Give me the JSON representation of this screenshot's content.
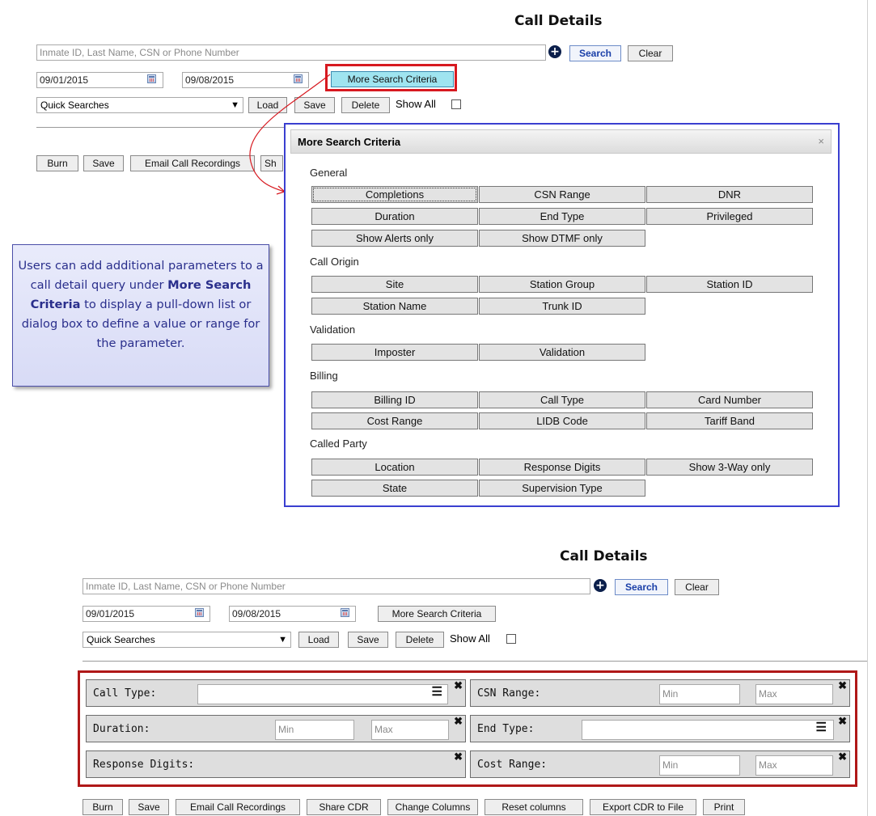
{
  "top": {
    "title": "Call Details",
    "search_placeholder": "Inmate ID, Last Name, CSN or Phone Number",
    "search_label": "Search",
    "clear_label": "Clear",
    "start_date": "09/01/2015",
    "end_date": "09/08/2015",
    "more_label": "More Search Criteria",
    "quick_searches": "Quick Searches",
    "load_label": "Load",
    "save_label": "Save",
    "delete_label": "Delete",
    "show_all_label": "Show All",
    "action_buttons": [
      "Burn",
      "Save",
      "Email Call Recordings",
      "Sh"
    ]
  },
  "dialog": {
    "title": "More Search Criteria",
    "close": "×",
    "sections": {
      "general": {
        "label": "General",
        "items": [
          "Completions",
          "CSN Range",
          "DNR",
          "Duration",
          "End Type",
          "Privileged",
          "Show Alerts only",
          "Show DTMF only"
        ]
      },
      "call_origin": {
        "label": "Call Origin",
        "items": [
          "Site",
          "Station Group",
          "Station ID",
          "Station Name",
          "Trunk ID"
        ]
      },
      "validation": {
        "label": "Validation",
        "items": [
          "Imposter",
          "Validation"
        ]
      },
      "billing": {
        "label": "Billing",
        "items": [
          "Billing ID",
          "Call Type",
          "Card Number",
          "Cost Range",
          "LIDB Code",
          "Tariff Band"
        ]
      },
      "called_party": {
        "label": "Called Party",
        "items": [
          "Location",
          "Response Digits",
          "Show 3-Way only",
          "State",
          "Supervision Type"
        ]
      }
    }
  },
  "callout": {
    "part1": "Users can add additional parameters to a call detail query under ",
    "bold": "More Search Criteria",
    "part2": " to display a pull-down list or dialog box to define a value or range for the parameter."
  },
  "bottom": {
    "title": "Call Details",
    "search_placeholder": "Inmate ID, Last Name, CSN or Phone Number",
    "search_label": "Search",
    "clear_label": "Clear",
    "start_date": "09/01/2015",
    "end_date": "09/08/2015",
    "more_label": "More Search Criteria",
    "quick_searches": "Quick Searches",
    "load_label": "Load",
    "save_label": "Save",
    "delete_label": "Delete",
    "show_all_label": "Show All",
    "filters": {
      "call_type": "Call Type:",
      "csn_range": "CSN Range:",
      "duration": "Duration:",
      "end_type": "End Type:",
      "response_digits": "Response Digits:",
      "cost_range": "Cost Range:",
      "min": "Min",
      "max": "Max",
      "remove": "✖"
    },
    "action_buttons": [
      "Burn",
      "Save",
      "Email Call Recordings",
      "Share CDR",
      "Change Columns",
      "Reset columns",
      "Export CDR to File",
      "Print"
    ]
  },
  "colors": {
    "dialog_border": "#3a3fd0",
    "highlight_red": "#d71920",
    "panel_border": "#b01818",
    "active_button": "#9fe4f0"
  },
  "icons": [
    "plus-circle-icon",
    "calendar-icon",
    "close-icon",
    "list-icon",
    "remove-icon",
    "chevron-down-icon"
  ]
}
